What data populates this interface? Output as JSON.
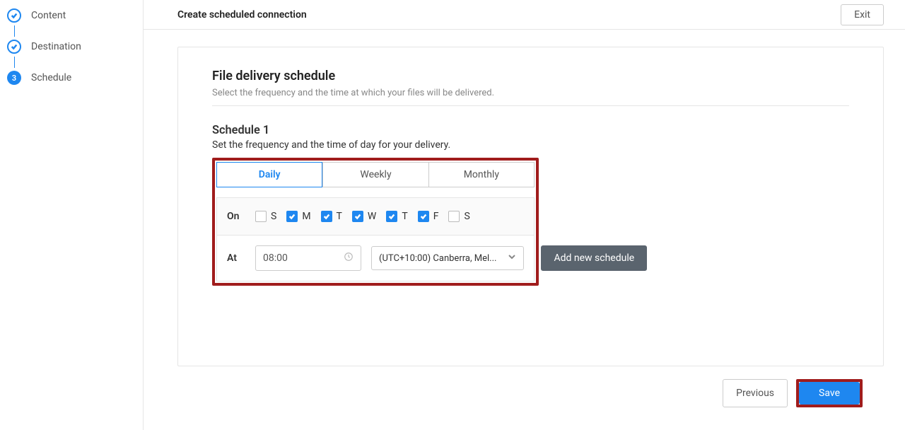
{
  "sidebar": {
    "steps": [
      {
        "label": "Content",
        "state": "done"
      },
      {
        "label": "Destination",
        "state": "done"
      },
      {
        "label": "Schedule",
        "state": "current",
        "number": "3"
      }
    ]
  },
  "topbar": {
    "title": "Create scheduled connection",
    "exit_label": "Exit"
  },
  "section": {
    "title": "File delivery schedule",
    "subtitle": "Select the frequency and the time at which your files will be delivered."
  },
  "schedule": {
    "title": "Schedule 1",
    "subtitle": "Set the frequency and the time of day for your delivery.",
    "tabs": {
      "daily": "Daily",
      "weekly": "Weekly",
      "monthly": "Monthly"
    },
    "on_label": "On",
    "days": [
      {
        "label": "S",
        "checked": false
      },
      {
        "label": "M",
        "checked": true
      },
      {
        "label": "T",
        "checked": true
      },
      {
        "label": "W",
        "checked": true
      },
      {
        "label": "T",
        "checked": true
      },
      {
        "label": "F",
        "checked": true
      },
      {
        "label": "S",
        "checked": false
      }
    ],
    "at_label": "At",
    "time_value": "08:00",
    "timezone_value": "(UTC+10:00) Canberra, Mel..."
  },
  "add_schedule_label": "Add new schedule",
  "footer": {
    "previous_label": "Previous",
    "save_label": "Save"
  }
}
